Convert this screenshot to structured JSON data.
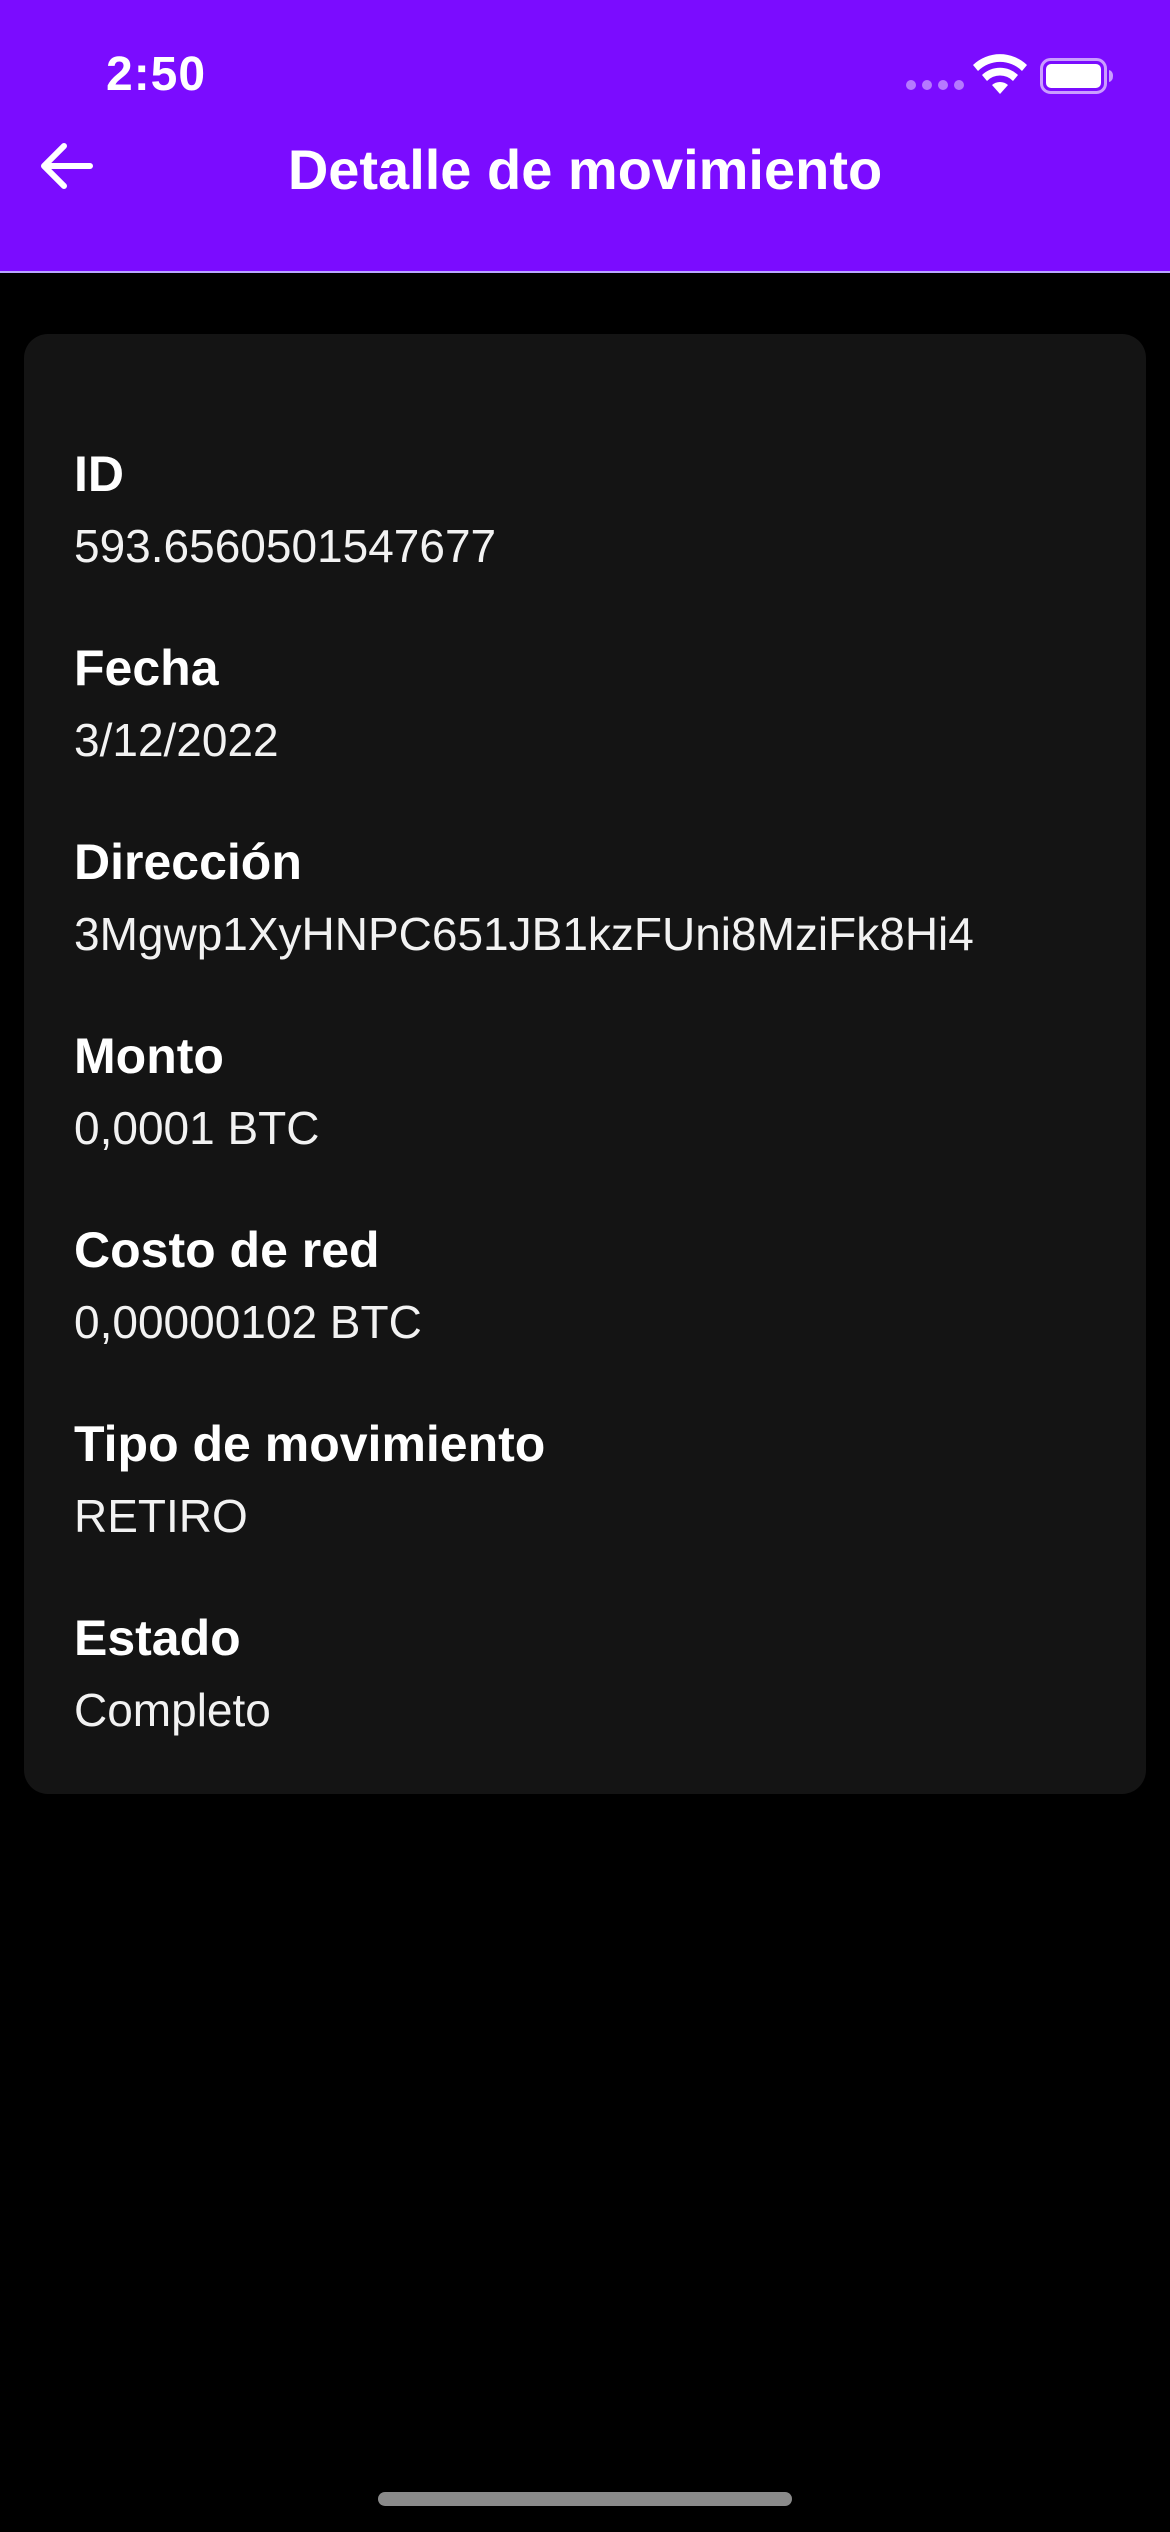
{
  "status_bar": {
    "time": "2:50"
  },
  "header": {
    "title": "Detalle de movimiento",
    "background": "#7b0cff"
  },
  "details": [
    {
      "label": "ID",
      "value": "593.6560501547677"
    },
    {
      "label": "Fecha",
      "value": "3/12/2022"
    },
    {
      "label": "Dirección",
      "value": "3Mgwp1XyHNPC651JB1kzFUni8MziFk8Hi4"
    },
    {
      "label": "Monto",
      "value": "0,0001 BTC"
    },
    {
      "label": "Costo de red",
      "value": "0,00000102 BTC"
    },
    {
      "label": "Tipo de movimiento",
      "value": "RETIRO"
    },
    {
      "label": "Estado",
      "value": "Completo"
    }
  ],
  "icons": {
    "back": "arrow-left-icon",
    "wifi": "wifi-icon",
    "battery": "battery-icon",
    "signal": "cellular-signal-icon"
  }
}
